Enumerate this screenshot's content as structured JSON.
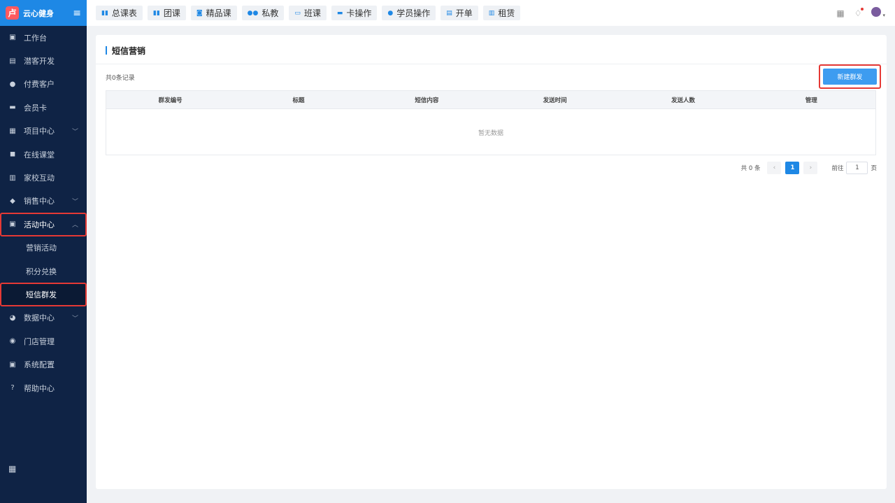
{
  "brand": {
    "logo_glyph": "卢",
    "name": "云心健身",
    "menu_icon": "hamburger-icon"
  },
  "sidebar": {
    "items": [
      {
        "label": "工作台",
        "icon": "workbench-icon",
        "glyph": "▣"
      },
      {
        "label": "潜客开发",
        "icon": "id-card-icon",
        "glyph": "▤"
      },
      {
        "label": "付费客户",
        "icon": "users-icon",
        "glyph": "●"
      },
      {
        "label": "会员卡",
        "icon": "card-icon",
        "glyph": "▬"
      },
      {
        "label": "项目中心",
        "icon": "folder-icon",
        "glyph": "▦",
        "chevron": "﹀"
      },
      {
        "label": "在线课堂",
        "icon": "briefcase-icon",
        "glyph": "◼"
      },
      {
        "label": "家校互动",
        "icon": "contact-book-icon",
        "glyph": "▥"
      },
      {
        "label": "销售中心",
        "icon": "tag-icon",
        "glyph": "◆",
        "chevron": "﹀"
      },
      {
        "label": "活动中心",
        "icon": "activity-icon",
        "glyph": "▣",
        "chevron": "︿"
      },
      {
        "label": "营销活动",
        "sub": true
      },
      {
        "label": "积分兑换",
        "sub": true
      },
      {
        "label": "短信群发",
        "sub": true
      },
      {
        "label": "数据中心",
        "icon": "pie-chart-icon",
        "glyph": "◕",
        "chevron": "﹀"
      },
      {
        "label": "门店管理",
        "icon": "store-icon",
        "glyph": "◉"
      },
      {
        "label": "系统配置",
        "icon": "monitor-icon",
        "glyph": "▣"
      },
      {
        "label": "帮助中心",
        "icon": "help-icon",
        "glyph": "?"
      }
    ],
    "bottom_icon": "apps-grid-icon",
    "bottom_glyph": "▦"
  },
  "topnav": {
    "tabs": [
      {
        "label": "总课表",
        "glyph": "▮▮"
      },
      {
        "label": "团课",
        "glyph": "▮▮"
      },
      {
        "label": "精品课",
        "glyph": "◙"
      },
      {
        "label": "私教",
        "glyph": "●●"
      },
      {
        "label": "班课",
        "glyph": "▭"
      },
      {
        "label": "卡操作",
        "glyph": "▬"
      },
      {
        "label": "学员操作",
        "glyph": "●"
      },
      {
        "label": "开单",
        "glyph": "▤"
      },
      {
        "label": "租赁",
        "glyph": "▥"
      }
    ],
    "right_icons": {
      "qr": "▦",
      "bell": "♢",
      "caret": "▾"
    }
  },
  "main": {
    "title": "短信营销",
    "record_count": "共0条记录",
    "new_button": "新建群发",
    "table": {
      "columns": [
        "群发编号",
        "标题",
        "短信内容",
        "发送时间",
        "发送人数",
        "管理"
      ],
      "empty_text": "暂无数据"
    },
    "pager": {
      "total": "共 0 条",
      "prev": "‹",
      "current": "1",
      "next": "›",
      "goto_label": "前往",
      "goto_value": "1",
      "page_suffix": "页"
    }
  },
  "colors": {
    "sidebar_bg": "#0f2345",
    "brand_bg": "#1e88e5",
    "primary": "#3d9cf0",
    "highlight_box": "#e53935"
  }
}
